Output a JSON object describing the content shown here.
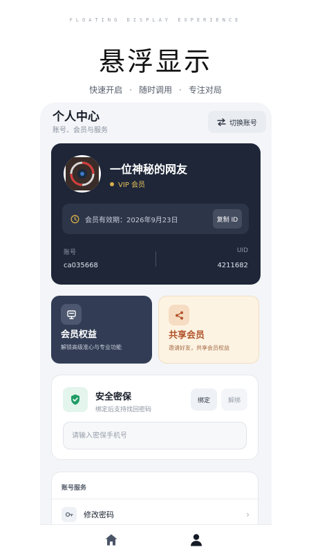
{
  "header": {
    "tagline": "FLOATING DISPLAY EXPERIENCE",
    "title": "悬浮显示",
    "features": [
      "快速开启",
      "随时调用",
      "专注对局"
    ]
  },
  "page": {
    "title": "个人中心",
    "subtitle": "账号、会员与服务",
    "switch_account": "切换账号"
  },
  "user": {
    "nickname": "一位神秘的网友",
    "badge": "VIP 会员",
    "expiry_label": "会员有效期：2026年9月23日",
    "copy_id": "复制 ID",
    "account_label": "账号",
    "account_value": "ca035668",
    "uid_label": "UID",
    "uid_value": "4211682"
  },
  "tiles": [
    {
      "title": "会员权益",
      "desc": "解锁高级准心与专业功能"
    },
    {
      "title": "共享会员",
      "desc": "邀请好友，共享会员权益"
    }
  ],
  "security": {
    "title": "安全密保",
    "desc": "绑定后支持找回密码",
    "bind": "绑定",
    "unbind": "解绑",
    "phone_placeholder": "请输入密保手机号"
  },
  "services": {
    "title": "账号服务",
    "items": [
      {
        "label": "修改密码"
      }
    ]
  },
  "colors": {
    "card_dark": "#1e2638",
    "tile_dark": "#323d55",
    "tile_light": "#fdf3e3",
    "vip_gold": "#d7ae4a",
    "accent_orange": "#b1542a",
    "shield_green": "#1f9d65"
  },
  "icons": [
    "swap-icon",
    "avatar-target-icon",
    "history-icon",
    "monitor-icon",
    "share-icon",
    "shield-icon",
    "key-icon",
    "chevron-right-icon",
    "home-icon",
    "user-icon"
  ]
}
